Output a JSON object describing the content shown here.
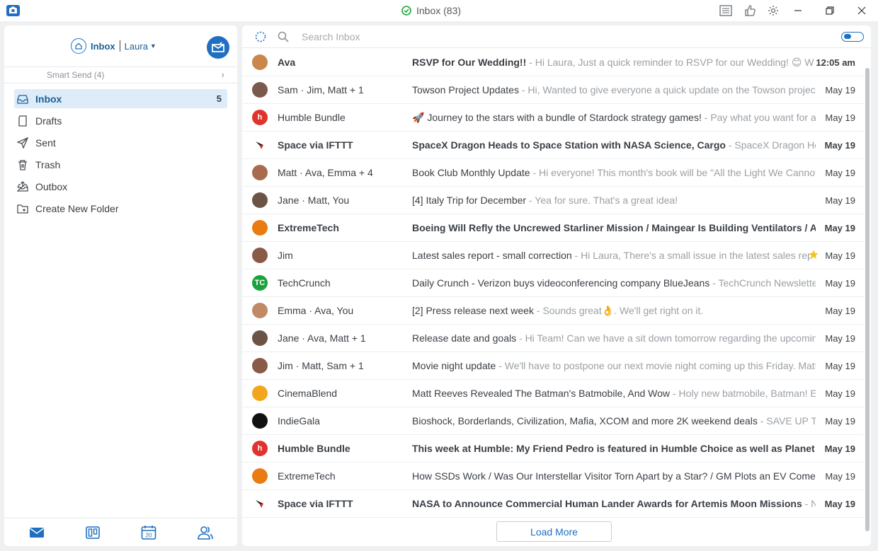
{
  "window": {
    "title": "Inbox (83)",
    "controls": [
      "minimize",
      "restore",
      "close"
    ]
  },
  "account": {
    "folder": "Inbox",
    "name": "Laura"
  },
  "smart_send": {
    "label": "Smart Send (4)"
  },
  "folders": [
    {
      "label": "Inbox",
      "count": "5",
      "icon": "inbox-icon",
      "active": true
    },
    {
      "label": "Drafts",
      "count": "",
      "icon": "drafts-icon"
    },
    {
      "label": "Sent",
      "count": "",
      "icon": "sent-icon"
    },
    {
      "label": "Trash",
      "count": "",
      "icon": "trash-icon"
    },
    {
      "label": "Outbox",
      "count": "",
      "icon": "outbox-icon"
    },
    {
      "label": "Create New Folder",
      "count": "",
      "icon": "new-folder-icon"
    }
  ],
  "search": {
    "placeholder": "Search Inbox"
  },
  "emails": [
    {
      "sender": "Ava",
      "subject": "RSVP for Our Wedding!!",
      "preview": "Hi Laura, Just a quick reminder to RSVP for our Wedding! 😊 W",
      "date": "12:05 am",
      "unread": true,
      "avatar_color": "#c9874a",
      "avatar_text": ""
    },
    {
      "sender": "Sam · Jim, Matt + 1",
      "subject": "Towson Project Updates",
      "preview": "Hi, Wanted to give everyone a quick update on the Towson project.",
      "date": "May 19",
      "unread": false,
      "avatar_color": "#7a5a4a",
      "avatar_text": ""
    },
    {
      "sender": "Humble Bundle",
      "subject": "🚀 Journey to the stars with a bundle of Stardock strategy games!",
      "preview": "Pay what you want for a",
      "date": "May 19",
      "unread": false,
      "avatar_color": "#e0332e",
      "avatar_text": "h"
    },
    {
      "sender": "Space via IFTTT",
      "subject": "SpaceX Dragon Heads to Space Station with NASA Science, Cargo",
      "preview": "SpaceX Dragon Hea",
      "date": "May 19",
      "unread": true,
      "avatar_color": "#ffffff",
      "avatar_text": ""
    },
    {
      "sender": "Matt · Ava, Emma + 4",
      "subject": "Book Club Monthly Update",
      "preview": "Hi everyone! This month's book will be \"All the Light We Cannot",
      "date": "May 19",
      "unread": false,
      "avatar_color": "#a86b4f",
      "avatar_text": ""
    },
    {
      "sender": "Jane · Matt, You",
      "subject": "[4] Italy Trip for December",
      "preview": "Yea for sure. That's a great idea!",
      "date": "May 19",
      "unread": false,
      "avatar_color": "#6b5446",
      "avatar_text": ""
    },
    {
      "sender": "ExtremeTech",
      "subject": "Boeing Will Refly the Uncrewed Starliner Mission / Maingear Is Building Ventilators / Asu",
      "preview": "",
      "date": "May 19",
      "unread": true,
      "avatar_color": "#e87b12",
      "avatar_text": ""
    },
    {
      "sender": "Jim",
      "subject": "Latest sales report - small correction",
      "preview": "Hi Laura, There's a small issue in the latest sales rep",
      "date": "May 19",
      "unread": false,
      "starred": true,
      "avatar_color": "#8a5a48",
      "avatar_text": ""
    },
    {
      "sender": "TechCrunch",
      "subject": "Daily Crunch - Verizon buys videoconferencing company BlueJeans",
      "preview": "TechCrunch Newsletter",
      "date": "May 19",
      "unread": false,
      "avatar_color": "#1aa33a",
      "avatar_text": "TC"
    },
    {
      "sender": "Emma · Ava, You",
      "subject": "[2] Press release next week",
      "preview": "Sounds great👌. We'll get right on it.",
      "date": "May 19",
      "unread": false,
      "avatar_color": "#c08a66",
      "avatar_text": ""
    },
    {
      "sender": "Jane · Ava, Matt + 1",
      "subject": "Release date and goals",
      "preview": "Hi Team! Can we have a sit down tomorrow regarding the upcoming",
      "date": "May 19",
      "unread": false,
      "avatar_color": "#6b5446",
      "avatar_text": ""
    },
    {
      "sender": "Jim · Matt, Sam + 1",
      "subject": "Movie night update",
      "preview": "We'll have to postpone our next movie night coming up this Friday. Matt",
      "date": "May 19",
      "unread": false,
      "avatar_color": "#8a5a48",
      "avatar_text": ""
    },
    {
      "sender": "CinemaBlend",
      "subject": "Matt Reeves Revealed The Batman's Batmobile, And Wow",
      "preview": "Holy new batmobile, Batman! Em",
      "date": "May 19",
      "unread": false,
      "avatar_color": "#f3a51c",
      "avatar_text": ""
    },
    {
      "sender": "IndieGala",
      "subject": "Bioshock, Borderlands, Civilization, Mafia, XCOM and more 2K weekend deals",
      "preview": "SAVE UP TO",
      "date": "May 19",
      "unread": false,
      "avatar_color": "#111111",
      "avatar_text": ""
    },
    {
      "sender": "Humble Bundle",
      "subject": "This week at Humble: My Friend Pedro is featured in Humble Choice as well as Planet Co",
      "preview": "",
      "date": "May 19",
      "unread": true,
      "avatar_color": "#e0332e",
      "avatar_text": "h"
    },
    {
      "sender": "ExtremeTech",
      "subject": "How SSDs Work / Was Our Interstellar Visitor Torn Apart by a Star? / GM Plots an EV Comebac",
      "preview": "",
      "date": "May 19",
      "unread": false,
      "avatar_color": "#e87b12",
      "avatar_text": ""
    },
    {
      "sender": "Space via IFTTT",
      "subject": "NASA to Announce Commercial Human Lander Awards for Artemis Moon Missions",
      "preview": "NA",
      "date": "May 19",
      "unread": true,
      "avatar_color": "#ffffff",
      "avatar_text": ""
    }
  ],
  "load_more": "Load More",
  "colors": {
    "accent": "#1f6fc2",
    "active_folder_bg": "#ddecf8",
    "star": "#f5c518"
  }
}
